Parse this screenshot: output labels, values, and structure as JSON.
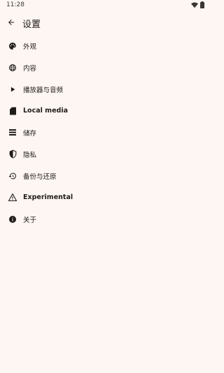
{
  "status_bar": {
    "time": "11:28",
    "icons": [
      "wifi-icon",
      "battery-icon"
    ]
  },
  "header": {
    "back_icon": "arrow-back-icon",
    "title": "设置"
  },
  "menu": {
    "items": [
      {
        "label": "外观",
        "icon": "palette-icon"
      },
      {
        "label": "内容",
        "icon": "globe-icon"
      },
      {
        "label": "播放器与音频",
        "icon": "play-icon"
      },
      {
        "label": "Local media",
        "icon": "sd-card-icon"
      },
      {
        "label": "储存",
        "icon": "storage-list-icon"
      },
      {
        "label": "隐私",
        "icon": "shield-icon"
      },
      {
        "label": "备份与还原",
        "icon": "restore-history-icon"
      },
      {
        "label": "Experimental",
        "icon": "warning-triangle-icon"
      },
      {
        "label": "关于",
        "icon": "info-icon"
      }
    ]
  },
  "colors": {
    "background": "#fdf6f3",
    "text": "#1f1b19"
  }
}
